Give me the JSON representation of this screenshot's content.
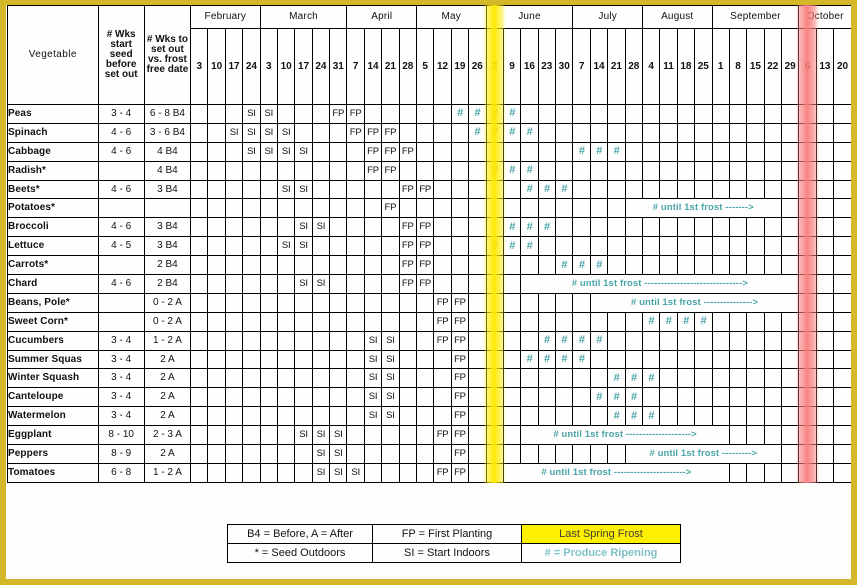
{
  "table": {
    "col_headers": {
      "vegetable": "Vegetable",
      "wks_start_seed": "# Wks start seed before set out",
      "wks_set_out": "# Wks to set out vs. frost free date"
    },
    "months": [
      {
        "name": "February",
        "days": [
          "3",
          "10",
          "17",
          "24"
        ]
      },
      {
        "name": "March",
        "days": [
          "3",
          "10",
          "17",
          "24",
          "31"
        ]
      },
      {
        "name": "April",
        "days": [
          "7",
          "14",
          "21",
          "28"
        ]
      },
      {
        "name": "May",
        "days": [
          "5",
          "12",
          "19",
          "26"
        ]
      },
      {
        "name": "June",
        "days": [
          "2",
          "9",
          "16",
          "23",
          "30"
        ]
      },
      {
        "name": "July",
        "days": [
          "7",
          "14",
          "21",
          "28"
        ]
      },
      {
        "name": "August",
        "days": [
          "4",
          "11",
          "18",
          "25"
        ]
      },
      {
        "name": "September",
        "days": [
          "1",
          "8",
          "15",
          "22",
          "29"
        ]
      },
      {
        "name": "October",
        "days": [
          "6",
          "13",
          "20"
        ]
      }
    ],
    "last_spring_frost_column": 17,
    "first_fall_frost_column": 35,
    "rows": [
      {
        "name": "Peas",
        "wks_seed": "3 - 4",
        "wks_out": "6 - 8 B4",
        "si": [
          3,
          4
        ],
        "fp": [
          8,
          9
        ],
        "rp": [
          15,
          16,
          17,
          18
        ],
        "frost_text": null,
        "frost_start": null,
        "frost_span": null
      },
      {
        "name": "Spinach",
        "wks_seed": "4 - 6",
        "wks_out": "3 - 6 B4",
        "si": [
          2,
          3,
          4,
          5
        ],
        "fp": [
          9,
          10,
          11
        ],
        "rp": [
          16,
          17,
          18,
          19
        ],
        "frost_text": null,
        "frost_start": null,
        "frost_span": null
      },
      {
        "name": "Cabbage",
        "wks_seed": "4 - 6",
        "wks_out": "4 B4",
        "si": [
          3,
          4,
          5,
          6
        ],
        "fp": [
          10,
          11,
          12
        ],
        "rp": [
          22,
          23,
          24
        ],
        "frost_text": null,
        "frost_start": null,
        "frost_span": null
      },
      {
        "name": "Radish*",
        "wks_seed": "",
        "wks_out": "4 B4",
        "si": [],
        "fp": [
          10,
          11
        ],
        "rp": [
          17,
          18,
          19
        ],
        "frost_text": null,
        "frost_start": null,
        "frost_span": null
      },
      {
        "name": "Beets*",
        "wks_seed": "4 - 6",
        "wks_out": "3 B4",
        "si": [
          5,
          6
        ],
        "fp": [
          12,
          13
        ],
        "rp": [
          19,
          20,
          21
        ],
        "frost_text": null,
        "frost_start": null,
        "frost_span": null
      },
      {
        "name": "Potatoes*",
        "wks_seed": "",
        "wks_out": "",
        "si": [],
        "fp": [
          11
        ],
        "rp": [],
        "frost_text": "until 1st frost ------->",
        "frost_start": 25,
        "frost_span": 9
      },
      {
        "name": "Broccoli",
        "wks_seed": "4 - 6",
        "wks_out": "3 B4",
        "si": [
          6,
          7
        ],
        "fp": [
          12,
          13
        ],
        "rp": [
          18,
          19,
          20
        ],
        "frost_text": null,
        "frost_start": null,
        "frost_span": null
      },
      {
        "name": "Lettuce",
        "wks_seed": "4 - 5",
        "wks_out": "3 B4",
        "si": [
          5,
          6
        ],
        "fp": [
          12,
          13
        ],
        "rp": [
          17,
          18,
          19
        ],
        "frost_text": null,
        "frost_start": null,
        "frost_span": null
      },
      {
        "name": "Carrots*",
        "wks_seed": "",
        "wks_out": "2 B4",
        "si": [],
        "fp": [
          12,
          13
        ],
        "rp": [
          21,
          22,
          23
        ],
        "frost_text": null,
        "frost_start": null,
        "frost_span": null
      },
      {
        "name": "Chard",
        "wks_seed": "4 - 6",
        "wks_out": "2 B4",
        "si": [
          6,
          7
        ],
        "fp": [
          12,
          13
        ],
        "rp": [],
        "frost_text": "until 1st frost ------------------------------>",
        "frost_start": 19,
        "frost_span": 16
      },
      {
        "name": "Beans, Pole*",
        "wks_seed": "",
        "wks_out": "0 - 2 A",
        "si": [],
        "fp": [
          14,
          15
        ],
        "rp": [],
        "frost_text": "until 1st frost --------------->",
        "frost_start": 23,
        "frost_span": 12
      },
      {
        "name": "Sweet Corn*",
        "wks_seed": "",
        "wks_out": "0 - 2 A",
        "si": [],
        "fp": [
          14,
          15
        ],
        "rp": [
          26,
          27,
          28,
          29
        ],
        "frost_text": null,
        "frost_start": null,
        "frost_span": null
      },
      {
        "name": "Cucumbers",
        "wks_seed": "3 - 4",
        "wks_out": "1 - 2 A",
        "si": [
          10,
          11
        ],
        "fp": [
          14,
          15
        ],
        "rp": [
          20,
          21,
          22,
          23
        ],
        "frost_text": null,
        "frost_start": null,
        "frost_span": null
      },
      {
        "name": "Summer Squas",
        "wks_seed": "3 - 4",
        "wks_out": "2 A",
        "si": [
          10,
          11
        ],
        "fp": [
          15
        ],
        "rp": [
          19,
          20,
          21,
          22
        ],
        "frost_text": null,
        "frost_start": null,
        "frost_span": null
      },
      {
        "name": "Winter Squash",
        "wks_seed": "3 - 4",
        "wks_out": "2 A",
        "si": [
          10,
          11
        ],
        "fp": [
          15
        ],
        "rp": [
          24,
          25,
          26
        ],
        "frost_text": null,
        "frost_start": null,
        "frost_span": null
      },
      {
        "name": "Canteloupe",
        "wks_seed": "3 - 4",
        "wks_out": "2 A",
        "si": [
          10,
          11
        ],
        "fp": [
          15
        ],
        "rp": [
          23,
          24,
          25
        ],
        "frost_text": null,
        "frost_start": null,
        "frost_span": null
      },
      {
        "name": "Watermelon",
        "wks_seed": "3 - 4",
        "wks_out": "2 A",
        "si": [
          10,
          11
        ],
        "fp": [
          15
        ],
        "rp": [
          24,
          25,
          26
        ],
        "frost_text": null,
        "frost_start": null,
        "frost_span": null
      },
      {
        "name": "Eggplant",
        "wks_seed": "8 - 10",
        "wks_out": "2 - 3 A",
        "si": [
          6,
          7,
          8
        ],
        "fp": [
          14,
          15
        ],
        "rp": [],
        "frost_text": "until 1st frost -------------------->",
        "frost_start": 19,
        "frost_span": 12
      },
      {
        "name": "Peppers",
        "wks_seed": "8 - 9",
        "wks_out": "2 A",
        "si": [
          7,
          8
        ],
        "fp": [
          15
        ],
        "rp": [],
        "frost_text": "until 1st frost --------->",
        "frost_start": 25,
        "frost_span": 9
      },
      {
        "name": "Tomatoes",
        "wks_seed": "6 - 8",
        "wks_out": "1 - 2 A",
        "si": [
          7,
          8,
          9
        ],
        "fp": [
          14,
          15
        ],
        "rp": [],
        "frost_text": "until 1st frost ---------------------->",
        "frost_start": 18,
        "frost_span": 13
      }
    ]
  },
  "legend": {
    "r1c1": "B4 = Before, A = After",
    "r1c2": "FP = First Planting",
    "r1c3": "Last Spring Frost",
    "r2c1": "* = Seed Outdoors",
    "r2c2": "SI = Start Indoors",
    "r2c3": "# = Produce Ripening"
  },
  "markers": {
    "si": "SI",
    "fp": "FP",
    "rp": "#"
  },
  "colors": {
    "border": "#d4b829",
    "frost_yellow": "#ffef00",
    "fall_frost_pink": "#f97c7c",
    "ripening_teal": "#4ba5a8",
    "grid": "#000000"
  }
}
